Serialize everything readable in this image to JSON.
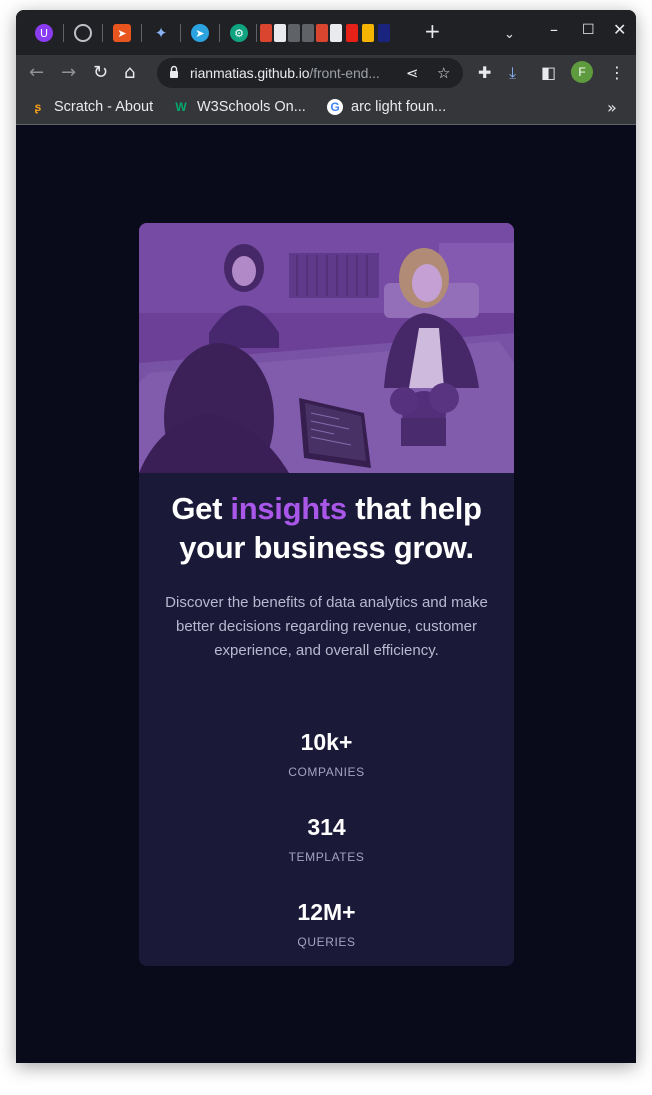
{
  "browser": {
    "omnibox": {
      "host": "rianmatias.github.io",
      "path": "/front-end..."
    },
    "bookmarks": [
      {
        "label": "Scratch - About"
      },
      {
        "label": "W3Schools On..."
      },
      {
        "label": "arc light foun..."
      }
    ],
    "profile_initial": "F"
  },
  "page": {
    "headline_before": "Get ",
    "headline_accent": "insights",
    "headline_after": " that help your business grow.",
    "description": "Discover the benefits of data analytics and make better decisions regarding revenue, customer experience, and overall efficiency.",
    "stats": [
      {
        "value": "10k+",
        "label": "COMPANIES"
      },
      {
        "value": "314",
        "label": "TEMPLATES"
      },
      {
        "value": "12M+",
        "label": "QUERIES"
      }
    ]
  },
  "colors": {
    "page_bg": "#090b1b",
    "card_bg": "#1b1938",
    "accent": "#a957e8",
    "image_tint": "#6a3e98"
  }
}
